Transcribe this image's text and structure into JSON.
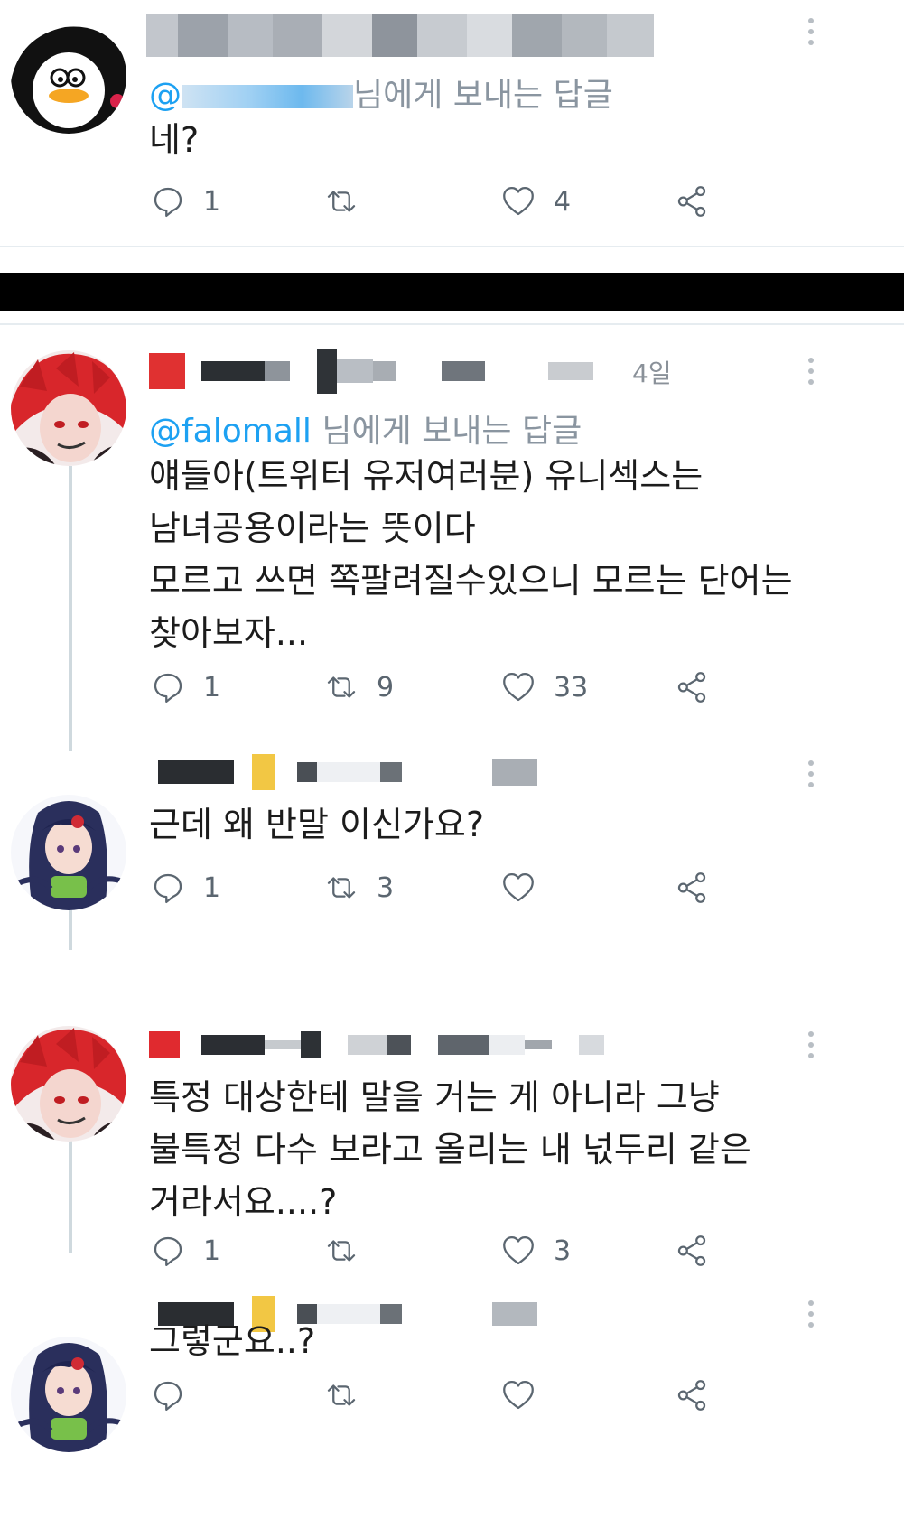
{
  "tweets": [
    {
      "mention_prefix": "@",
      "mention_suffix": "님에게 보내는 답글",
      "text": "네?",
      "reply_count": "1",
      "retweet_count": "",
      "like_count": "4"
    },
    {
      "time_hint": "4일",
      "mention_handle": "@falomall",
      "mention_suffix": " 님에게 보내는 답글",
      "text": "얘들아(트위터 유저여러분) 유니섹스는\n남녀공용이라는 뜻이다\n모르고 쓰면 쪽팔려질수있으니 모르는 단어는\n찾아보자...",
      "reply_count": "1",
      "retweet_count": "9",
      "like_count": "33"
    },
    {
      "text": "근데 왜 반말 이신가요?",
      "reply_count": "1",
      "retweet_count": "3",
      "like_count": ""
    },
    {
      "text": "특정 대상한테 말을 거는 게 아니라 그냥\n불특정 다수 보라고 올리는 내 넋두리 같은\n거라서요....?",
      "reply_count": "1",
      "retweet_count": "",
      "like_count": "3"
    },
    {
      "text": "그렇군요..?",
      "reply_count": "",
      "retweet_count": "",
      "like_count": ""
    }
  ],
  "icons": {
    "reply": "reply-icon",
    "retweet": "retweet-icon",
    "like": "heart-icon",
    "share": "share-icon",
    "more": "more-options-icon"
  },
  "colors": {
    "link": "#1da1f2",
    "icon": "#5b6670",
    "divider": "#e6ecf0"
  }
}
